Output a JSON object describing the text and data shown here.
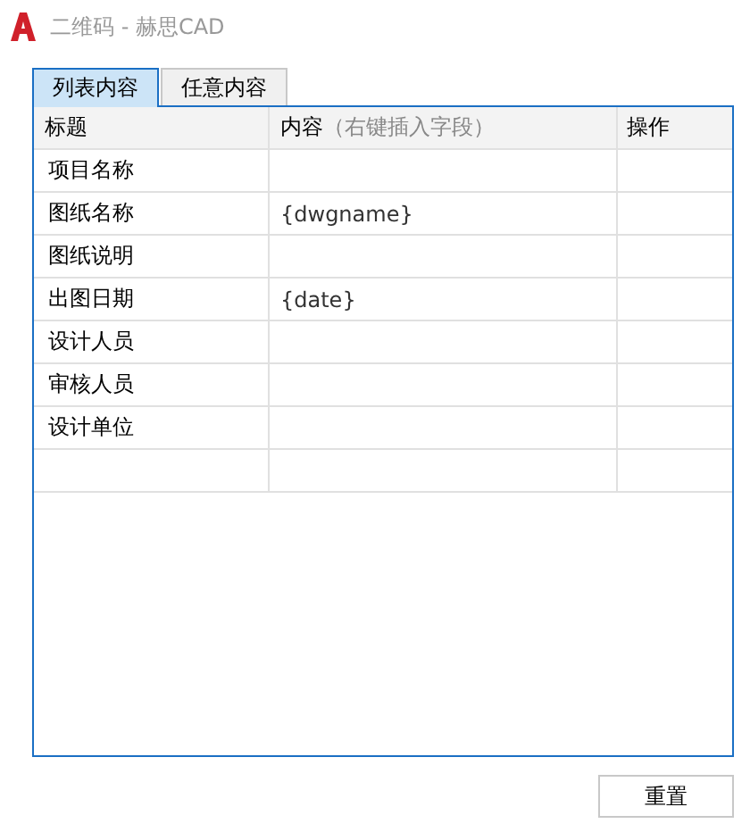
{
  "window": {
    "title": "二维码 - 赫思CAD"
  },
  "tabs": [
    {
      "label": "列表内容",
      "selected": true
    },
    {
      "label": "任意内容",
      "selected": false
    }
  ],
  "table": {
    "columns": [
      {
        "label": "标题"
      },
      {
        "label": "内容",
        "hint": "（右键插入字段）"
      },
      {
        "label": "操作"
      }
    ],
    "rows": [
      {
        "title": "项目名称"
      },
      {
        "title": "图纸名称",
        "content": "{dwgname}"
      },
      {
        "title": "图纸说明"
      },
      {
        "title": "出图日期",
        "content": "{date}"
      },
      {
        "title": "设计人员"
      },
      {
        "title": "审核人员"
      },
      {
        "title": "设计单位"
      }
    ]
  },
  "buttons": [
    {
      "label": "重置"
    }
  ]
}
